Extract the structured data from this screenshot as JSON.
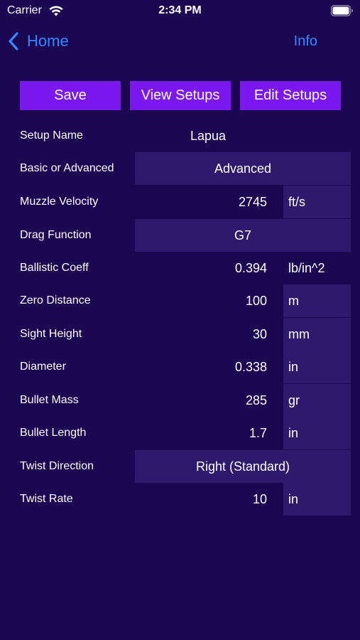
{
  "status_bar": {
    "carrier": "Carrier",
    "time": "2:34 PM"
  },
  "nav": {
    "back_label": "Home",
    "info_label": "Info"
  },
  "toolbar": {
    "save_label": "Save",
    "view_setups_label": "View Setups",
    "edit_setups_label": "Edit Setups"
  },
  "form": {
    "setup_name": {
      "label": "Setup Name",
      "value": "Lapua"
    },
    "basic_or_advanced": {
      "label": "Basic or Advanced",
      "value": "Advanced"
    },
    "muzzle_velocity": {
      "label": "Muzzle Velocity",
      "value": "2745",
      "unit": "ft/s"
    },
    "drag_function": {
      "label": "Drag Function",
      "value": "G7"
    },
    "ballistic_coeff": {
      "label": "Ballistic Coeff",
      "value": "0.394",
      "unit": "lb/in^2"
    },
    "zero_distance": {
      "label": "Zero Distance",
      "value": "100",
      "unit": "m"
    },
    "sight_height": {
      "label": "Sight Height",
      "value": "30",
      "unit": "mm"
    },
    "diameter": {
      "label": "Diameter",
      "value": "0.338",
      "unit": "in"
    },
    "bullet_mass": {
      "label": "Bullet Mass",
      "value": "285",
      "unit": "gr"
    },
    "bullet_length": {
      "label": "Bullet Length",
      "value": "1.7",
      "unit": "in"
    },
    "twist_direction": {
      "label": "Twist Direction",
      "value": "Right (Standard)"
    },
    "twist_rate": {
      "label": "Twist Rate",
      "value": "10",
      "unit": "in"
    }
  },
  "colors": {
    "background": "#1b0752",
    "accent_button": "#7b18f0",
    "field_box": "#2e1a6c",
    "link": "#2f8cff"
  }
}
